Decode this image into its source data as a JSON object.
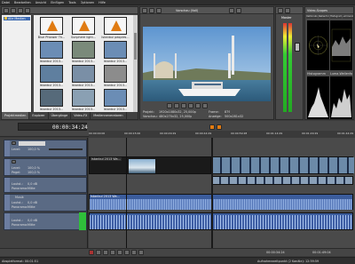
{
  "menubar": {
    "items": [
      "Datei",
      "Bearbeiten",
      "Ansicht",
      "Einfügen",
      "Tools",
      "Optionen",
      "Hilfe"
    ]
  },
  "explorer": {
    "tree_item": "Alle Medien",
    "media": [
      {
        "label": "Blue Phlower Th...",
        "color": "#c97b2c"
      },
      {
        "label": "Sunphere light...",
        "color": "#c97b2c"
      },
      {
        "label": "Istanbul peoples...",
        "color": "#c97b2c"
      },
      {
        "label": "Istanbul 2013...",
        "color": "#6b8db5"
      },
      {
        "label": "Istanbul 2013...",
        "color": "#7a8a7a"
      },
      {
        "label": "Istanbul 2013...",
        "color": "#6b8db5"
      },
      {
        "label": "Istanbul 2013...",
        "color": "#5f7f9f"
      },
      {
        "label": "Istanbul 2013...",
        "color": "#7a8fa6"
      },
      {
        "label": "Istanbul 2013...",
        "color": "#8c8c8c"
      },
      {
        "label": "Istanbul 2013...",
        "color": "#566a7a"
      },
      {
        "label": "Istanbul 2013...",
        "color": "#8aa0b3"
      },
      {
        "label": "Istanbul 2013...",
        "color": "#6b8db5"
      }
    ],
    "tabs": [
      "Projektmedien",
      "Explorer",
      "Übergänge",
      "Video-FX",
      "Medienneneratoren"
    ]
  },
  "preview": {
    "toolbar_label": "Vorschau (Voll)",
    "info_rows": [
      {
        "label": "Projekt:",
        "value": "1920x1080x32, 25,000p"
      },
      {
        "label": "Vorschau:",
        "value": "480x270x32, 25,000p"
      },
      {
        "label": "Frame:",
        "value": "879"
      },
      {
        "label": "Anzeige:",
        "value": "500x281x32"
      }
    ]
  },
  "master": {
    "label": "Master"
  },
  "scopes": {
    "toolbar_label": "Video-Scopes",
    "tab_labels": [
      "Vektorskop",
      "Wellenform",
      "Histogramm",
      "Luminanz"
    ],
    "bottom_labels": [
      "Histogramm",
      "Luma-Wellenform"
    ]
  },
  "timeline": {
    "timecode": "00:00:34:24",
    "ruler": [
      "00:00:00:00",
      "00:00:15:00",
      "00:00:29:29",
      "00:00:44:29",
      "00:00:59:28",
      "00:01:14:29",
      "00:01:29:29",
      "00:01:44:29"
    ],
    "clip_labels": {
      "video1": "Istanbul 2013 Wa...",
      "video2": "Istanbul 2013 Wa...",
      "audio1": "Istanbul 2013 Wa...",
      "audio2": "Istanbul 2013 Wa...",
      "audio3": "Istanbul 2013 Wa..."
    },
    "tracks": [
      {
        "name": "Level:",
        "value": "100,0 %"
      },
      {
        "name": "Level:",
        "value": "100,0 %"
      },
      {
        "name": "Pegel:",
        "value": "100,0 %"
      },
      {
        "name": "Lautst.:",
        "value": "0,0 dB"
      },
      {
        "name": "Panorama:",
        "value": "Mitte"
      },
      {
        "name": "Musik",
        "value": "Touch"
      },
      {
        "name": "Lautst.:",
        "value": "0,0 dB"
      },
      {
        "name": "Panorama:",
        "value": "Mitte"
      },
      {
        "name": "Lautst.:",
        "value": "0,0 dB"
      },
      {
        "name": "Panorama:",
        "value": "Mitte"
      }
    ],
    "transport_time": "00:00:34:24",
    "end_time": "00:01:49:04"
  },
  "statusbar": {
    "left": "Abspielformat: 00:01:51",
    "right": "Aufnahmezeitpunkt (2 Kanäle): 12:59:59"
  },
  "colors": {
    "accent": "#e07b12",
    "audio_clip": "#3b5c9c",
    "track_header": "#5a6a84"
  }
}
